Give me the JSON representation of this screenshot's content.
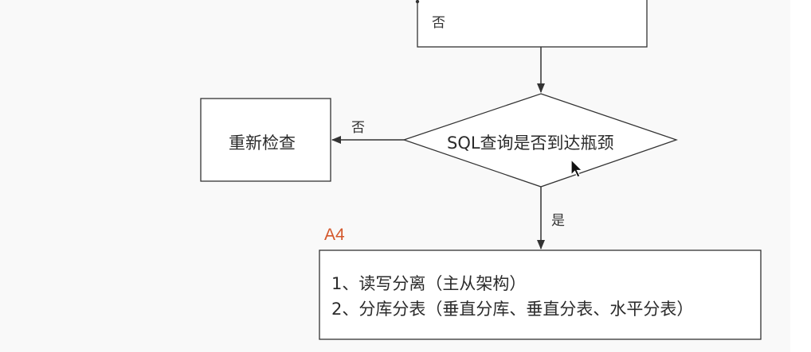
{
  "colors": {
    "background": "#f9f9f9",
    "stroke": "#333333",
    "node_fill": "#ffffff",
    "annotation": "#d4572b"
  },
  "nodes": {
    "top_box_label": "否",
    "recheck": "重新检查",
    "decision": "SQL查询是否到达瓶颈",
    "result_lines": [
      "1、读写分离（主从架构）",
      "2、分库分表（垂直分库、垂直分表、水平分表）"
    ]
  },
  "edges": {
    "no_label": "否",
    "yes_label": "是"
  },
  "annotation": "A4",
  "cursor_icon": "mouse-pointer-icon"
}
